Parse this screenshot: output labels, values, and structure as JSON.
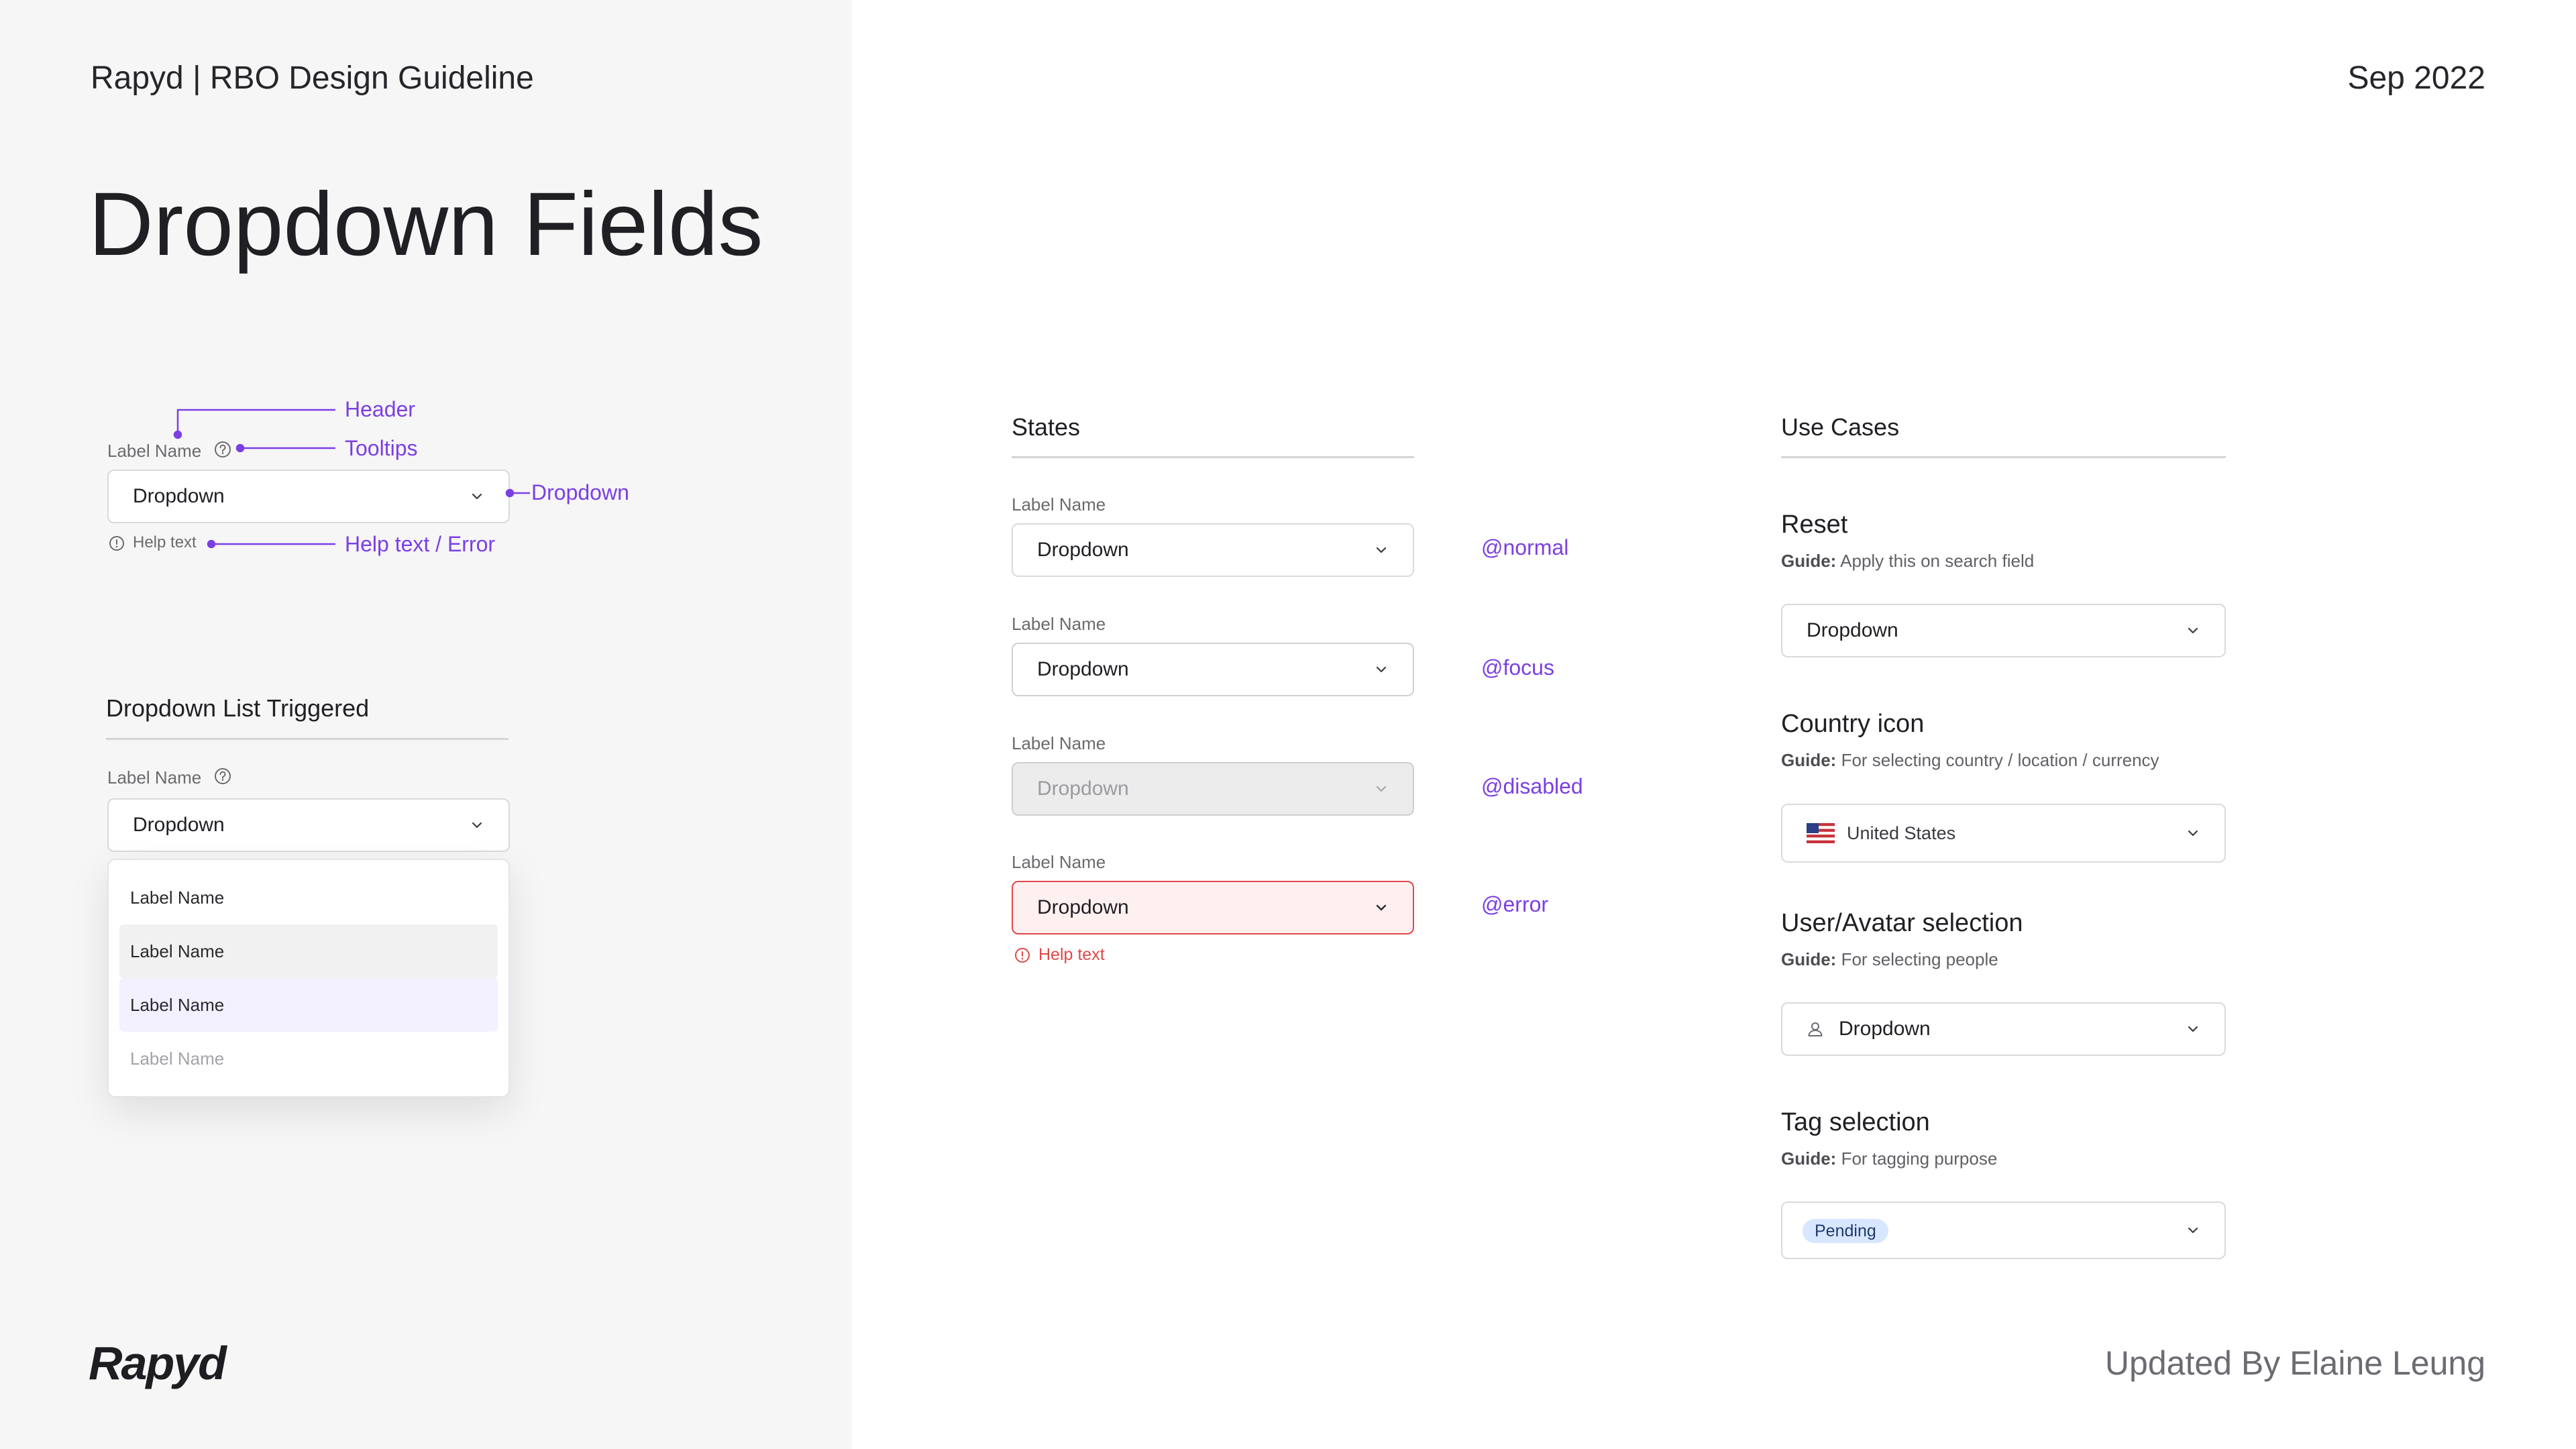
{
  "header": {
    "brand_line": "Rapyd | RBO Design Guideline",
    "date": "Sep 2022",
    "page_title": "Dropdown Fields"
  },
  "anatomy": {
    "label": "Label Name",
    "field_value": "Dropdown",
    "help_text": "Help text",
    "annotations": {
      "header": "Header",
      "tooltips": "Tooltips",
      "dropdown": "Dropdown",
      "help": "Help text / Error"
    }
  },
  "list_triggered": {
    "title": "Dropdown List Triggered",
    "label": "Label Name",
    "field_value": "Dropdown",
    "options": [
      "Label Name",
      "Label Name",
      "Label Name",
      "Label Name"
    ]
  },
  "states": {
    "title": "States",
    "items": [
      {
        "label": "Label Name",
        "value": "Dropdown",
        "tag": "@normal"
      },
      {
        "label": "Label Name",
        "value": "Dropdown",
        "tag": "@focus"
      },
      {
        "label": "Label Name",
        "value": "Dropdown",
        "tag": "@disabled"
      },
      {
        "label": "Label Name",
        "value": "Dropdown",
        "tag": "@error",
        "help": "Help text"
      }
    ]
  },
  "use_cases": {
    "title": "Use Cases",
    "guide_prefix": "Guide:",
    "items": [
      {
        "title": "Reset",
        "guide": "Apply this on search field",
        "value": "Dropdown"
      },
      {
        "title": "Country icon",
        "guide": "For selecting country / location / currency",
        "value": "United States",
        "icon": "us-flag-icon"
      },
      {
        "title": "User/Avatar selection",
        "guide": "For selecting people",
        "value": "Dropdown",
        "icon": "user-icon"
      },
      {
        "title": "Tag selection",
        "guide": "For tagging purpose",
        "value": "Pending"
      }
    ]
  },
  "footer": {
    "logo": "Rapyd",
    "updated_by": "Updated By Elaine Leung"
  },
  "colors": {
    "accent": "#7b3fe4",
    "error": "#e04848",
    "error_bg": "#fff0f0",
    "disabled_bg": "#ececec",
    "hover_bg": "#f1f1f1",
    "selected_bg": "#f3f0ff",
    "tag_bg": "#d9e6ff"
  }
}
